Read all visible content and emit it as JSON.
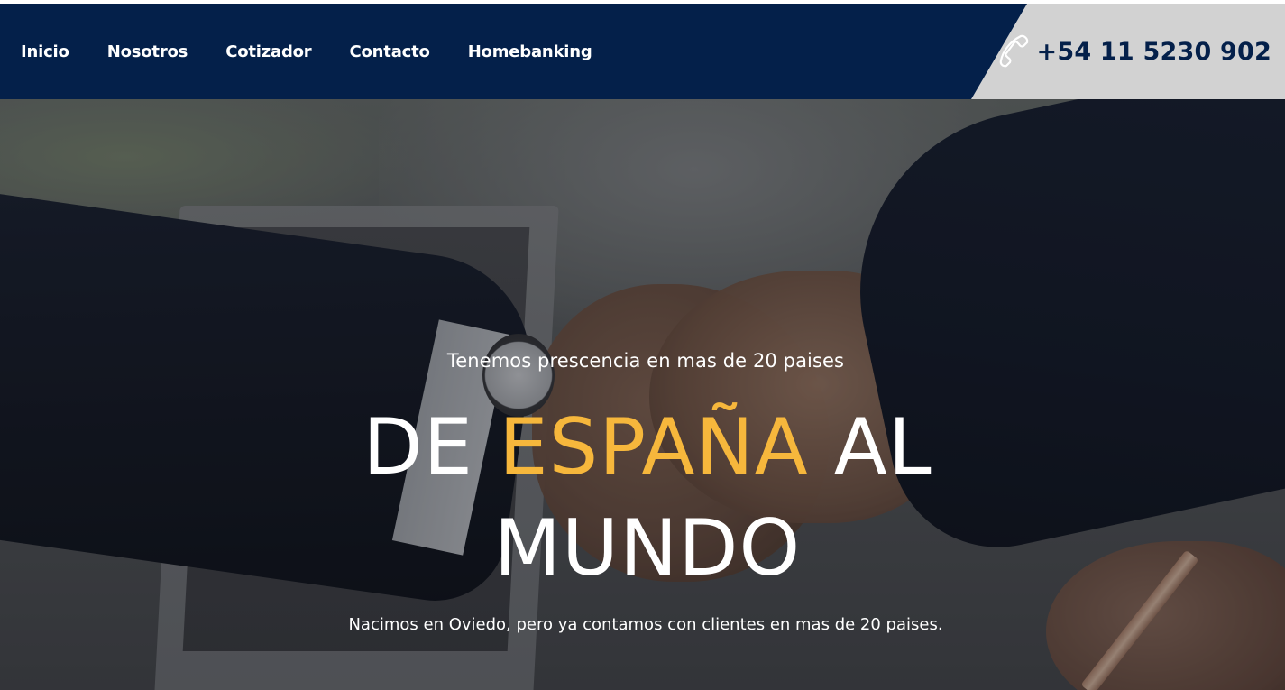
{
  "nav": {
    "items": [
      {
        "label": "Inicio"
      },
      {
        "label": "Nosotros"
      },
      {
        "label": "Cotizador"
      },
      {
        "label": "Contacto"
      },
      {
        "label": "Homebanking"
      }
    ]
  },
  "contact": {
    "phone": "+54 11 5230 902",
    "icon": "phone-icon"
  },
  "hero": {
    "eyebrow": "Tenemos prescencia en mas de 20 paises",
    "headline": {
      "part1": "DE",
      "accent": "ESPAÑA",
      "part2": "AL",
      "line2": "MUNDO"
    },
    "subtext": "Nacimos en Oviedo, pero ya contamos con clientes en mas de 20 paises."
  },
  "colors": {
    "header_bg": "#04204a",
    "phone_box_bg": "#d2d2d2",
    "accent": "#f6b73c",
    "text_light": "#ffffff"
  }
}
